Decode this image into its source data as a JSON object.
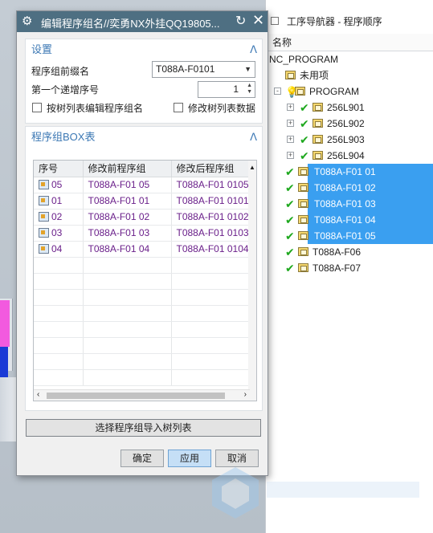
{
  "navigator": {
    "title": "工序导航器 - 程序顺序",
    "column_header": "名称",
    "tree": [
      {
        "label": "NC_PROGRAM",
        "kind": "root"
      },
      {
        "label": "未用项",
        "kind": "folder"
      },
      {
        "label": "PROGRAM",
        "kind": "program"
      },
      {
        "label": "256L901",
        "kind": "group",
        "expand": "+"
      },
      {
        "label": "256L902",
        "kind": "group",
        "expand": "+"
      },
      {
        "label": "256L903",
        "kind": "group",
        "expand": "+"
      },
      {
        "label": "256L904",
        "kind": "group",
        "expand": "+"
      },
      {
        "label": "T088A-F01 01",
        "kind": "group",
        "selected": true
      },
      {
        "label": "T088A-F01 02",
        "kind": "group",
        "selected": true
      },
      {
        "label": "T088A-F01 03",
        "kind": "group",
        "selected": true
      },
      {
        "label": "T088A-F01 04",
        "kind": "group",
        "selected": true
      },
      {
        "label": "T088A-F01 05",
        "kind": "group",
        "selected": true
      },
      {
        "label": "T088A-F06",
        "kind": "group"
      },
      {
        "label": "T088A-F07",
        "kind": "group"
      }
    ],
    "program_expand": "-",
    "selection_color": "#3a9ff0"
  },
  "dialog": {
    "title": "编辑程序组名//奕勇NX外挂QQ19805...",
    "settings": {
      "header": "设置",
      "prefix_label": "程序组前缀名",
      "prefix_value": "T088A-F0101",
      "first_seq_label": "第一个递增序号",
      "first_seq_value": "1",
      "edit_by_tree_label": "按树列表编辑程序组名",
      "modify_tree_label": "修改树列表数据"
    },
    "box": {
      "header": "程序组BOX表",
      "columns": [
        "序号",
        "修改前程序组",
        "修改后程序组"
      ],
      "rows": [
        [
          "05",
          "T088A-F01 05",
          "T088A-F01 0105"
        ],
        [
          "01",
          "T088A-F01 01",
          "T088A-F01 0101"
        ],
        [
          "02",
          "T088A-F01 02",
          "T088A-F01 0102"
        ],
        [
          "03",
          "T088A-F01 03",
          "T088A-F01 0103"
        ],
        [
          "04",
          "T088A-F01 04",
          "T088A-F01 0104"
        ]
      ]
    },
    "import_button": "选择程序组导入树列表",
    "ok_button": "确定",
    "apply_button": "应用",
    "cancel_button": "取消",
    "titlebar_color": "#4e6f82",
    "accent_color": "#3c78b4"
  },
  "icons": {
    "gear": "gear-icon",
    "reset": "reset-icon",
    "close": "close-icon",
    "collapse": "chevron-up-icon",
    "check": "checkmark-icon",
    "folder": "program-folder-icon"
  }
}
